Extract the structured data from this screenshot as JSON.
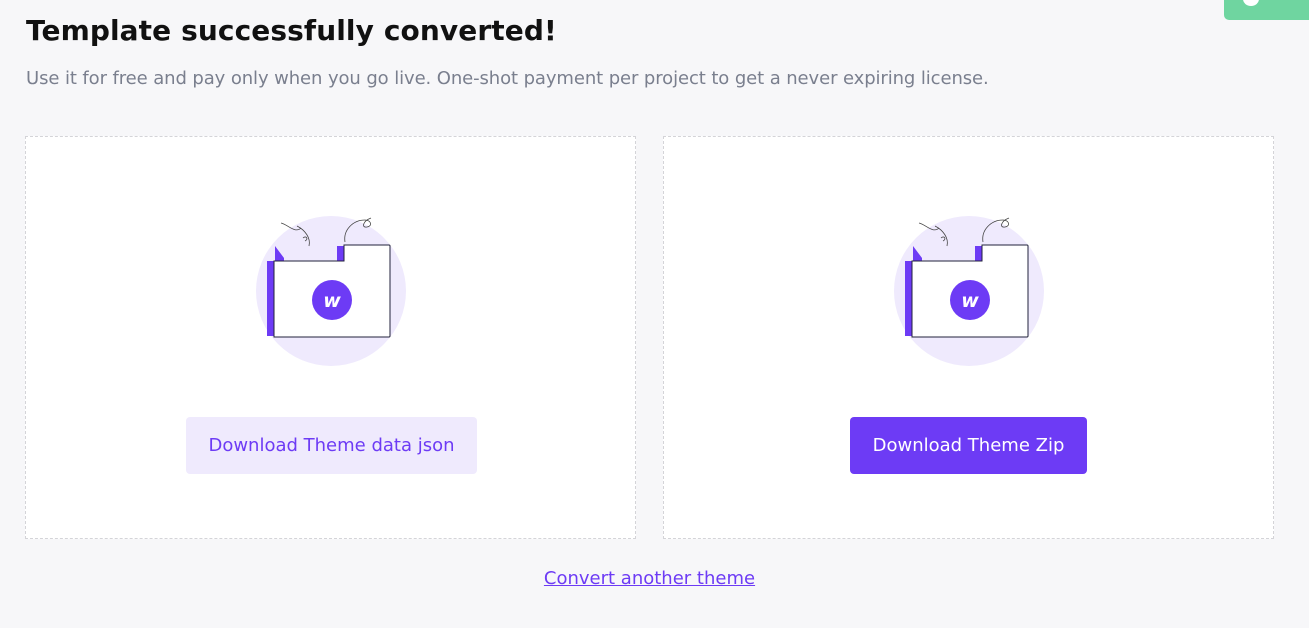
{
  "header": {
    "title": "Template successfully converted!",
    "subtitle": "Use it for free and pay only when you go live. One-shot payment per project to get a never expiring license."
  },
  "cards": [
    {
      "illustration_icon": "webflow-folder-icon",
      "logo_letter": "w",
      "button_label": "Download Theme data json"
    },
    {
      "illustration_icon": "webflow-folder-icon",
      "logo_letter": "w",
      "button_label": "Download Theme Zip"
    }
  ],
  "footer": {
    "link_label": "Convert another theme"
  },
  "colors": {
    "accent": "#6d3bf5",
    "accent_light": "#efeafd",
    "background": "#f7f7f9",
    "badge": "#6fd5a0"
  }
}
